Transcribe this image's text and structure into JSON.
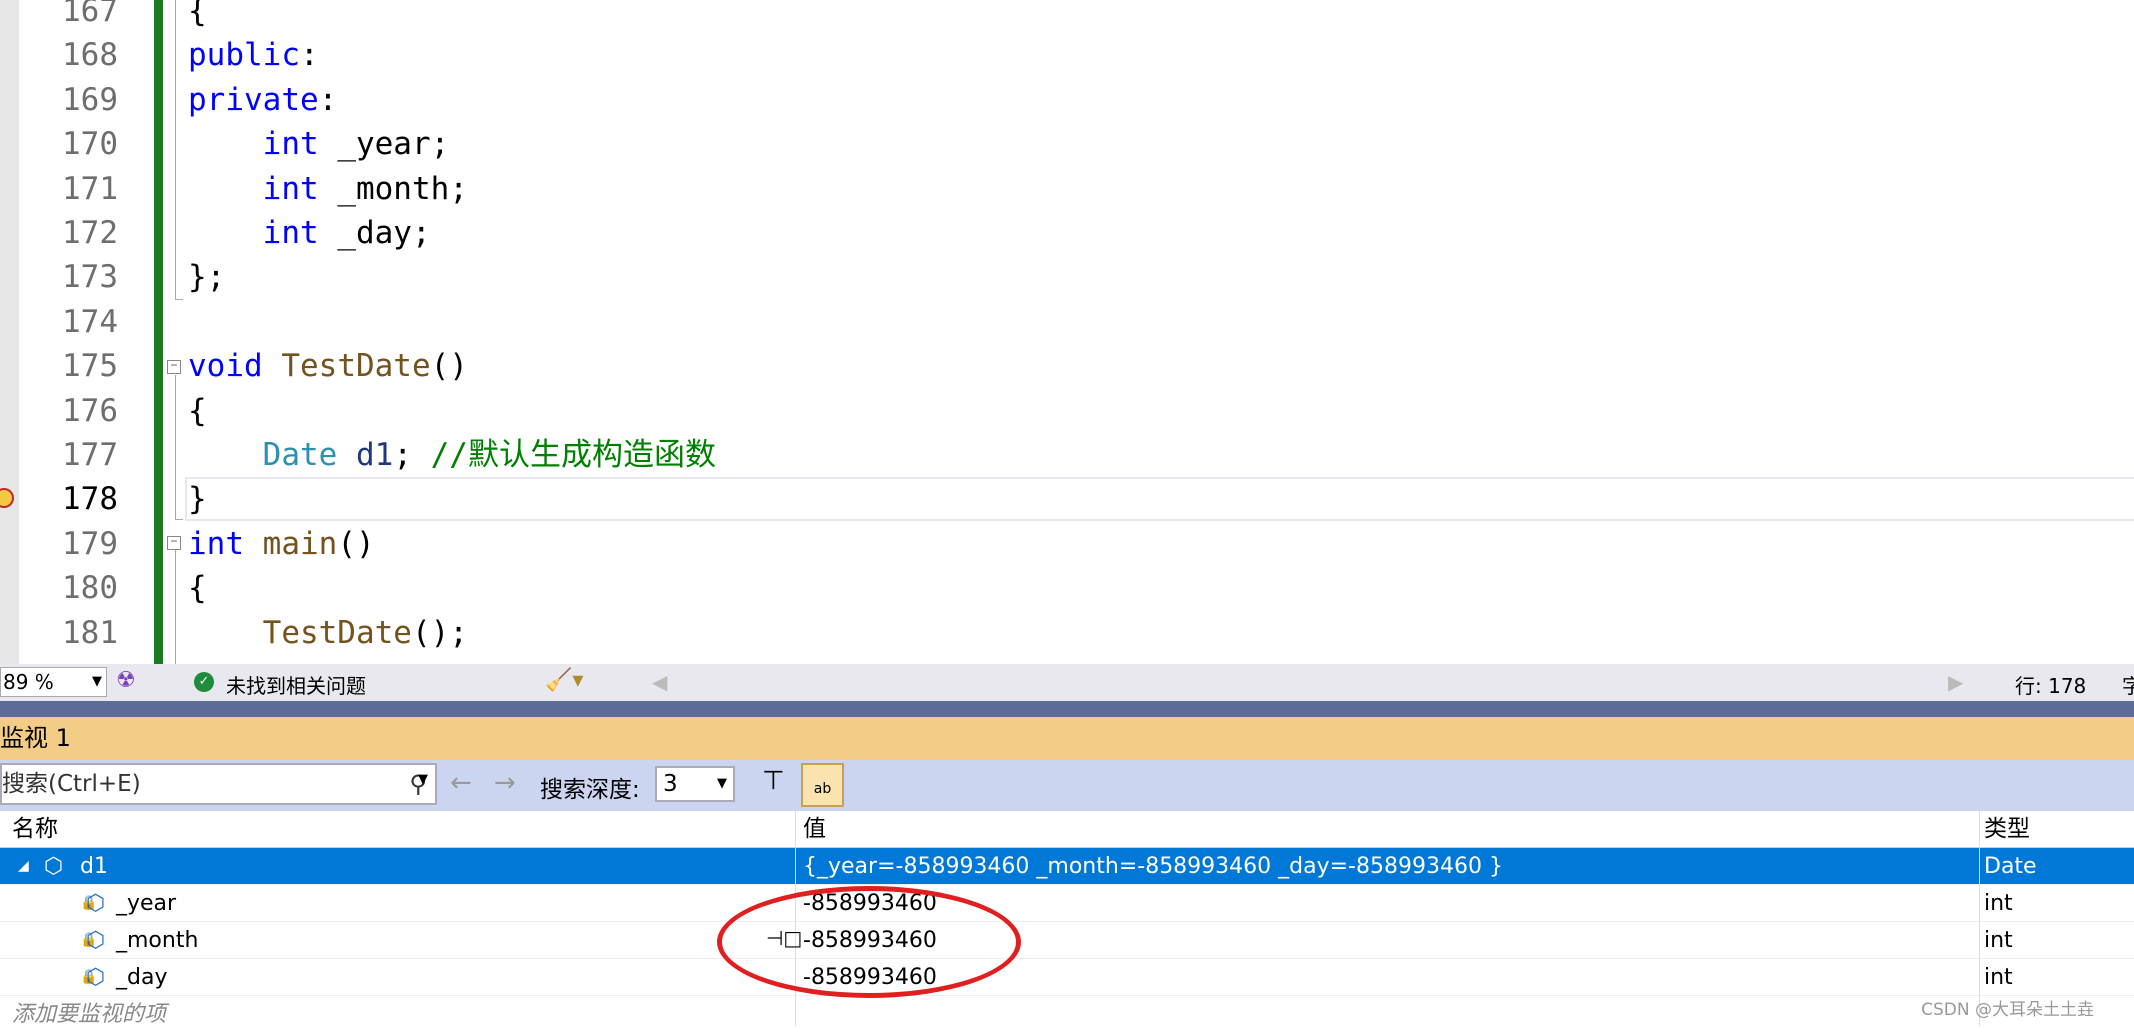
{
  "editor": {
    "lines": [
      {
        "n": "167",
        "code": [
          {
            "t": "{",
            "c": ""
          }
        ]
      },
      {
        "n": "168",
        "code": [
          {
            "t": "public",
            "c": "kw"
          },
          {
            "t": ":",
            "c": ""
          }
        ]
      },
      {
        "n": "169",
        "code": [
          {
            "t": "private",
            "c": "kw"
          },
          {
            "t": ":",
            "c": ""
          }
        ]
      },
      {
        "n": "170",
        "code": [
          {
            "t": "    ",
            "c": ""
          },
          {
            "t": "int",
            "c": "kw"
          },
          {
            "t": " _year;",
            "c": ""
          }
        ]
      },
      {
        "n": "171",
        "code": [
          {
            "t": "    ",
            "c": ""
          },
          {
            "t": "int",
            "c": "kw"
          },
          {
            "t": " _month;",
            "c": ""
          }
        ]
      },
      {
        "n": "172",
        "code": [
          {
            "t": "    ",
            "c": ""
          },
          {
            "t": "int",
            "c": "kw"
          },
          {
            "t": " _day;",
            "c": ""
          }
        ]
      },
      {
        "n": "173",
        "code": [
          {
            "t": "};",
            "c": ""
          }
        ]
      },
      {
        "n": "174",
        "code": []
      },
      {
        "n": "175",
        "code": [
          {
            "t": "void",
            "c": "kw"
          },
          {
            "t": " ",
            "c": ""
          },
          {
            "t": "TestDate",
            "c": "fn"
          },
          {
            "t": "()",
            "c": ""
          }
        ]
      },
      {
        "n": "176",
        "code": [
          {
            "t": "{",
            "c": ""
          }
        ]
      },
      {
        "n": "177",
        "code": [
          {
            "t": "    ",
            "c": ""
          },
          {
            "t": "Date",
            "c": "ty"
          },
          {
            "t": " ",
            "c": ""
          },
          {
            "t": "d1",
            "c": "var"
          },
          {
            "t": "; ",
            "c": ""
          },
          {
            "t": "//默认生成构造函数",
            "c": "cm"
          }
        ]
      },
      {
        "n": "178",
        "code": [
          {
            "t": "}",
            "c": ""
          }
        ]
      },
      {
        "n": "179",
        "code": [
          {
            "t": "int",
            "c": "kw"
          },
          {
            "t": " ",
            "c": ""
          },
          {
            "t": "main",
            "c": "fn"
          },
          {
            "t": "()",
            "c": ""
          }
        ]
      },
      {
        "n": "180",
        "code": [
          {
            "t": "{",
            "c": ""
          }
        ]
      },
      {
        "n": "181",
        "code": [
          {
            "t": "    ",
            "c": ""
          },
          {
            "t": "TestDate",
            "c": "fn"
          },
          {
            "t": "();",
            "c": ""
          }
        ]
      }
    ],
    "current_line": "178"
  },
  "status": {
    "zoom": "89 %",
    "issues": "未找到相关问题",
    "line": "行: 178",
    "next": "字"
  },
  "watch": {
    "title": "监视 1",
    "search_placeholder": "搜索(Ctrl+E)",
    "depth_label": "搜索深度:",
    "depth_value": "3",
    "columns": {
      "name": "名称",
      "value": "值",
      "type": "类型"
    },
    "rows": [
      {
        "name": "d1",
        "value": "{_year=-858993460 _month=-858993460 _day=-858993460 }",
        "type": "Date"
      },
      {
        "name": "_year",
        "value": "-858993460",
        "type": "int"
      },
      {
        "name": "_month",
        "value": "-858993460",
        "type": "int"
      },
      {
        "name": "_day",
        "value": "-858993460",
        "type": "int"
      }
    ],
    "add_placeholder": "添加要监视的项"
  },
  "watermark": "CSDN @大耳朵土土垚",
  "colors": {
    "selection": "#0078d7",
    "title": "#f3cc87",
    "toolbar": "#cbd5ef",
    "annotation": "#e02020"
  }
}
